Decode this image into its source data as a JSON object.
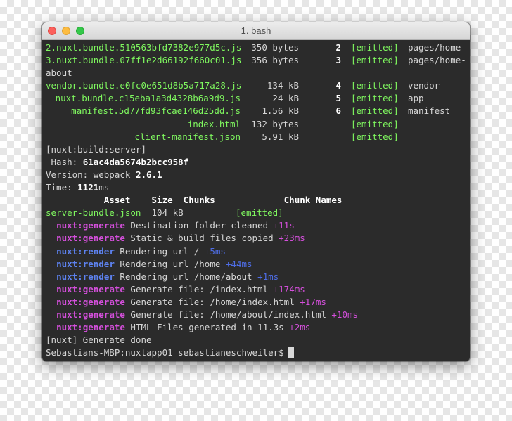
{
  "window": {
    "title": "1. bash"
  },
  "bundle_rows": [
    {
      "asset": "2.nuxt.bundle.510563bfd7382e977d5c.js",
      "size": "350 bytes",
      "chunk": "2",
      "status": "[emitted]",
      "name": "pages/home"
    },
    {
      "asset": "3.nuxt.bundle.07ff1e2d66192f660c01.js",
      "size": "356 bytes",
      "chunk": "3",
      "status": "[emitted]",
      "name": "pages/home-"
    },
    {
      "asset": "vendor.bundle.e0fc0e651d8b5a717a28.js",
      "size": "134 kB",
      "chunk": "4",
      "status": "[emitted]",
      "name": "vendor"
    },
    {
      "asset": "nuxt.bundle.c15eba1a3d4328b6a9d9.js",
      "size": "24 kB",
      "chunk": "5",
      "status": "[emitted]",
      "name": "app"
    },
    {
      "asset": "manifest.5d77fd93fcae146d25dd.js",
      "size": "1.56 kB",
      "chunk": "6",
      "status": "[emitted]",
      "name": "manifest"
    },
    {
      "asset": "index.html",
      "size": "132 bytes",
      "chunk": "",
      "status": "[emitted]",
      "name": ""
    },
    {
      "asset": "client-manifest.json",
      "size": "5.91 kB",
      "chunk": "",
      "status": "[emitted]",
      "name": ""
    }
  ],
  "wrap_text": "about",
  "server_build": {
    "header": "[nuxt:build:server]",
    "hash_label": " Hash: ",
    "hash_value": "61ac4da5674b2bcc958f",
    "version_label": "Version: webpack ",
    "version_value": "2.6.1",
    "time_label": "Time: ",
    "time_value": "1121",
    "time_unit": "ms",
    "table_header": "           Asset    Size  Chunks             Chunk Names",
    "server_asset": "server-bundle.json",
    "server_size": "  104 kB",
    "server_status": "[emitted]"
  },
  "log_lines": [
    {
      "tag": "nuxt:generate",
      "kind": "generate",
      "text": " Destination folder cleaned ",
      "timing": "+11s"
    },
    {
      "tag": "nuxt:generate",
      "kind": "generate",
      "text": " Static & build files copied ",
      "timing": "+23ms"
    },
    {
      "tag": "nuxt:render",
      "kind": "render",
      "text": " Rendering url / ",
      "timing": "+5ms"
    },
    {
      "tag": "nuxt:render",
      "kind": "render",
      "text": " Rendering url /home ",
      "timing": "+44ms"
    },
    {
      "tag": "nuxt:render",
      "kind": "render",
      "text": " Rendering url /home/about ",
      "timing": "+1ms"
    },
    {
      "tag": "nuxt:generate",
      "kind": "generate",
      "text": " Generate file: /index.html ",
      "timing": "+174ms"
    },
    {
      "tag": "nuxt:generate",
      "kind": "generate",
      "text": " Generate file: /home/index.html ",
      "timing": "+17ms"
    },
    {
      "tag": "nuxt:generate",
      "kind": "generate",
      "text": " Generate file: /home/about/index.html ",
      "timing": "+10ms"
    },
    {
      "tag": "nuxt:generate",
      "kind": "generate",
      "text": " HTML Files generated in 11.3s ",
      "timing": "+2ms"
    }
  ],
  "done_line": "[nuxt] Generate done",
  "prompt": "Sebastians-MBP:nuxtapp01 sebastianeschweiler$"
}
